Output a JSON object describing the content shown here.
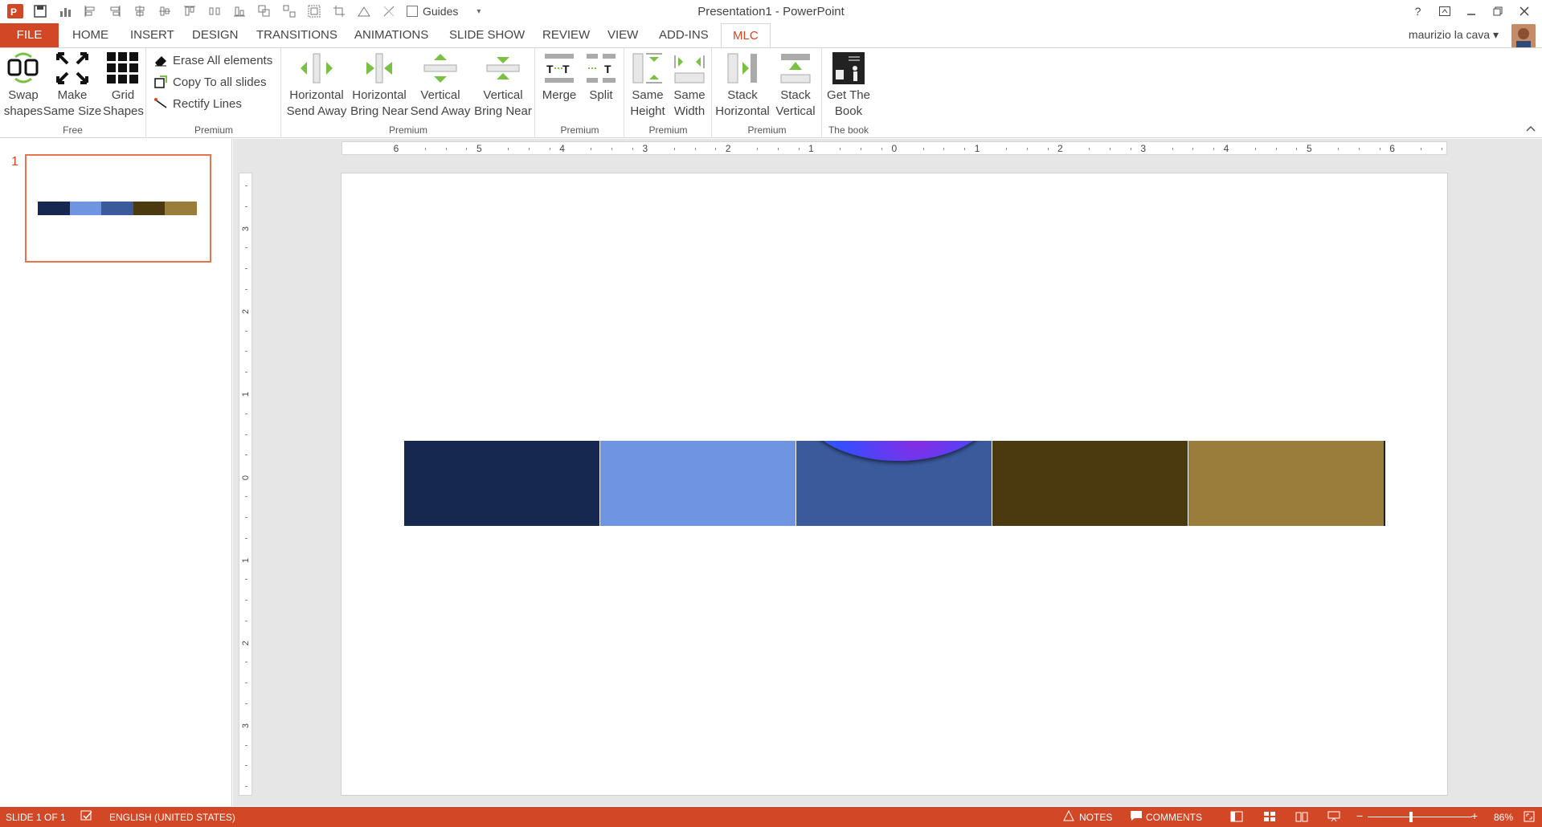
{
  "window": {
    "title": "Presentation1 - PowerPoint",
    "help": "?",
    "guides_label": "Guides"
  },
  "tabs": [
    {
      "label": "FILE"
    },
    {
      "label": "HOME"
    },
    {
      "label": "INSERT"
    },
    {
      "label": "DESIGN"
    },
    {
      "label": "TRANSITIONS"
    },
    {
      "label": "ANIMATIONS"
    },
    {
      "label": "SLIDE SHOW"
    },
    {
      "label": "REVIEW"
    },
    {
      "label": "VIEW"
    },
    {
      "label": "ADD-INS"
    },
    {
      "label": "MLC"
    }
  ],
  "active_tab": "MLC",
  "user": {
    "name": "maurizio la cava"
  },
  "ribbon": {
    "swap": {
      "l1": "Swap",
      "l2": "shapes"
    },
    "make": {
      "l1": "Make",
      "l2": "Same Size"
    },
    "grid": {
      "l1": "Grid",
      "l2": "Shapes"
    },
    "free_label": "Free",
    "erase": "Erase  All elements",
    "copy": "Copy To all slides",
    "rectify": "Rectify Lines",
    "premium1_label": "Premium",
    "hsa": {
      "l1": "Horizontal",
      "l2": "Send Away"
    },
    "hbn": {
      "l1": "Horizontal",
      "l2": "Bring Near"
    },
    "vsa": {
      "l1": "Vertical",
      "l2": "Send Away"
    },
    "vbn": {
      "l1": "Vertical",
      "l2": "Bring Near"
    },
    "premium2_label": "Premium",
    "merge": "Merge",
    "split": "Split",
    "premium3_label": "Premium",
    "sh": {
      "l1": "Same",
      "l2": "Height"
    },
    "sw": {
      "l1": "Same",
      "l2": "Width"
    },
    "premium4_label": "Premium",
    "stackh": {
      "l1": "Stack",
      "l2": "Horizontal"
    },
    "stackv": {
      "l1": "Stack",
      "l2": "Vertical"
    },
    "premium5_label": "Premium",
    "book": {
      "l1": "Get The",
      "l2": "Book"
    },
    "book_label": "The book"
  },
  "thumbnails": [
    {
      "number": "1"
    }
  ],
  "ruler": {
    "h": [
      "6",
      "5",
      "4",
      "3",
      "2",
      "1",
      "0",
      "1",
      "2",
      "3",
      "4",
      "5",
      "6"
    ],
    "v": [
      "3",
      "2",
      "1",
      "0",
      "1",
      "2",
      "3"
    ]
  },
  "slide": {
    "blocks": [
      "#16284f",
      "#6f94e2",
      "#3a5a9c",
      "#4b3a10",
      "#9a7d3a"
    ]
  },
  "status": {
    "slide": "SLIDE 1 OF 1",
    "language": "ENGLISH (UNITED STATES)",
    "notes": "NOTES",
    "comments": "COMMENTS",
    "zoom": "86%"
  },
  "colors": {
    "accent": "#d24726",
    "icon_green": "#7ac143"
  }
}
